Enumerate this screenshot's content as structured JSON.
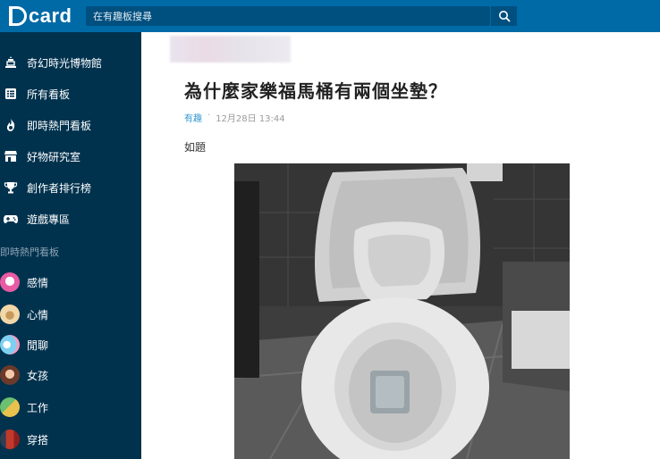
{
  "app": {
    "logo_text": "card"
  },
  "search": {
    "placeholder": "在有趣板搜尋"
  },
  "sidebar": {
    "nav": [
      {
        "label": "奇幻時光博物館",
        "icon": "museum-icon"
      },
      {
        "label": "所有看板",
        "icon": "list-icon"
      },
      {
        "label": "即時熱門看板",
        "icon": "fire-icon"
      },
      {
        "label": "好物研究室",
        "icon": "store-icon"
      },
      {
        "label": "創作者排行榜",
        "icon": "trophy-icon"
      },
      {
        "label": "遊戲專區",
        "icon": "gamepad-icon"
      }
    ],
    "section_title": "即時熱門看板",
    "boards": [
      {
        "label": "感情",
        "color": "#e85ba2"
      },
      {
        "label": "心情",
        "color": "#f2d7a8"
      },
      {
        "label": "閒聊",
        "color": "#7fd0f0"
      },
      {
        "label": "女孩",
        "color": "#d99b7f"
      },
      {
        "label": "工作",
        "color": "#e8c24d"
      },
      {
        "label": "穿搭",
        "color": "#c0392b"
      }
    ]
  },
  "post": {
    "title": "為什麼家樂福馬桶有兩個坐墊？",
    "forum": "有趣",
    "date": "12月28日 13:44",
    "body": "如題"
  },
  "colors": {
    "header": "#006aa6",
    "sidebar": "#00324e",
    "link": "#3397cf"
  }
}
